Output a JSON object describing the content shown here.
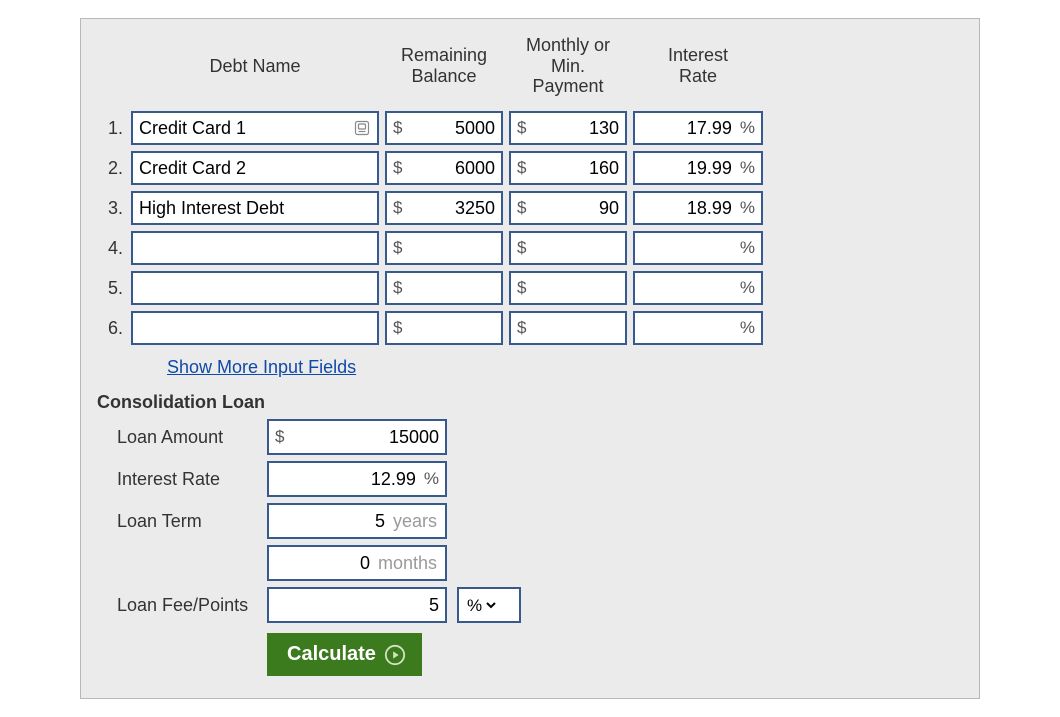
{
  "headers": {
    "debt_name": "Debt Name",
    "remaining_balance": "Remaining\nBalance",
    "min_payment": "Monthly or\nMin.\nPayment",
    "interest_rate": "Interest\nRate"
  },
  "currency_symbol": "$",
  "percent_symbol": "%",
  "rows": [
    {
      "n": "1.",
      "name": "Credit Card 1",
      "autofill": true,
      "balance": "5000",
      "payment": "130",
      "rate": "17.99"
    },
    {
      "n": "2.",
      "name": "Credit Card 2",
      "autofill": false,
      "balance": "6000",
      "payment": "160",
      "rate": "19.99"
    },
    {
      "n": "3.",
      "name": "High Interest Debt",
      "autofill": false,
      "balance": "3250",
      "payment": "90",
      "rate": "18.99"
    },
    {
      "n": "4.",
      "name": "",
      "autofill": false,
      "balance": "",
      "payment": "",
      "rate": ""
    },
    {
      "n": "5.",
      "name": "",
      "autofill": false,
      "balance": "",
      "payment": "",
      "rate": ""
    },
    {
      "n": "6.",
      "name": "",
      "autofill": false,
      "balance": "",
      "payment": "",
      "rate": ""
    }
  ],
  "show_more": "Show More Input Fields",
  "consolidation": {
    "title": "Consolidation Loan",
    "amount_label": "Loan Amount",
    "rate_label": "Interest Rate",
    "term_label": "Loan Term",
    "fee_label": "Loan Fee/Points",
    "amount": "15000",
    "rate": "12.99",
    "term_years": "5",
    "term_months": "0",
    "years_unit": "years",
    "months_unit": "months",
    "fee": "5",
    "fee_unit_selected": "%"
  },
  "calculate_label": "Calculate"
}
